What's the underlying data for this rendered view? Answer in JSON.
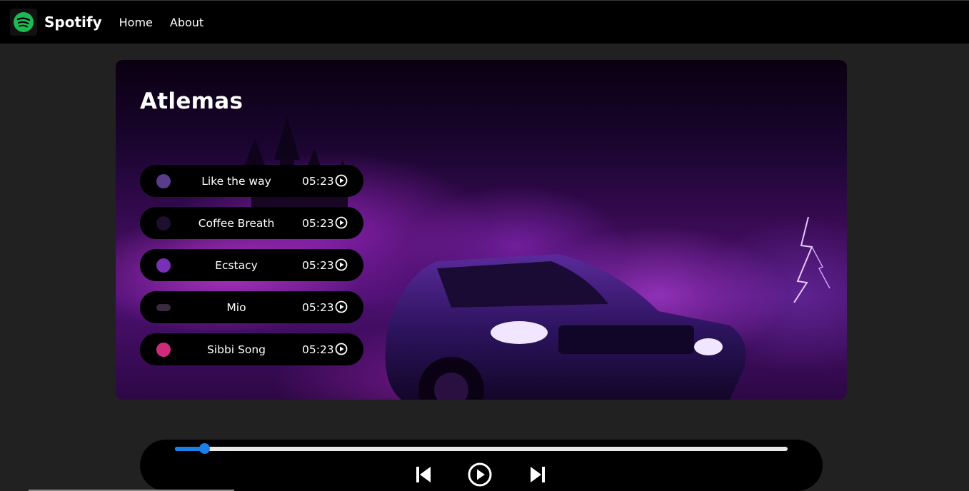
{
  "navbar": {
    "brand": "Spotify",
    "links": [
      "Home",
      "About"
    ],
    "logo_icon": "spotify-logo-icon"
  },
  "hero": {
    "title": "Atlemas"
  },
  "songs": [
    {
      "name": "Like the way",
      "duration": "05:23",
      "thumb_color": "#5a3d8a"
    },
    {
      "name": "Coffee Breath",
      "duration": "05:23",
      "thumb_color": "#1e0f2e"
    },
    {
      "name": "Ecstacy",
      "duration": "05:23",
      "thumb_color": "#7a2fb8"
    },
    {
      "name": "Mio",
      "duration": "05:23",
      "thumb_color": "#3a2a3f"
    },
    {
      "name": "Sibbi Song",
      "duration": "05:23",
      "thumb_color": "#d02b7a"
    }
  ],
  "player": {
    "progress": 0.048,
    "accent": "#1b7fe8"
  },
  "colors": {
    "background": "#212121",
    "navbar": "#000000",
    "brand_green": "#1db954"
  }
}
